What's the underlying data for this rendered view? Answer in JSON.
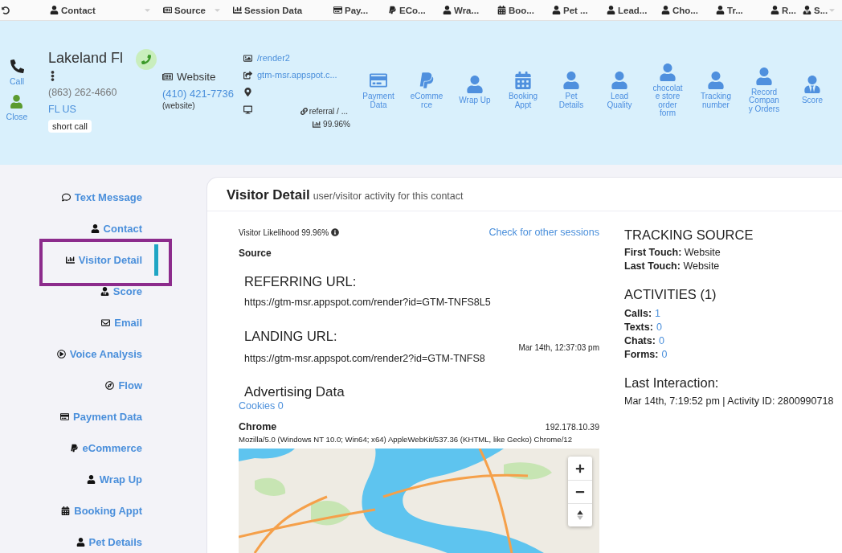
{
  "top_bar": {
    "items": [
      {
        "label": "Contact",
        "dropdown": true
      },
      {
        "label": "Source",
        "dropdown": true
      },
      {
        "label": "Session Data",
        "dropdown": false
      },
      {
        "label": "Pay...",
        "dropdown": false
      },
      {
        "label": "ECo...",
        "dropdown": false
      },
      {
        "label": "Wra...",
        "dropdown": false
      },
      {
        "label": "Boo...",
        "dropdown": false
      },
      {
        "label": "Pet ...",
        "dropdown": false
      },
      {
        "label": "Lead...",
        "dropdown": false
      },
      {
        "label": "Cho...",
        "dropdown": false
      },
      {
        "label": "Tr...",
        "dropdown": false
      },
      {
        "label": "R...",
        "dropdown": false
      },
      {
        "label": "S...",
        "dropdown": true
      }
    ]
  },
  "contact_header": {
    "actions": [
      {
        "label": "Call"
      },
      {
        "label": "Close"
      }
    ],
    "name": "Lakeland Fl",
    "phone": "(863) 262-4660",
    "location": "FL US",
    "tag": "short call",
    "source": {
      "name": "Website",
      "number": "(410) 421-7736",
      "note": "(website)"
    },
    "session": {
      "page": "/render2",
      "referrer": "gtm-msr.appspot.c...",
      "medium": "referral / ...",
      "likelihood": "99.96%"
    },
    "shortcuts": [
      {
        "label": "Payment Data"
      },
      {
        "label": "eCommerce"
      },
      {
        "label": "Wrap Up"
      },
      {
        "label": "Booking Appt"
      },
      {
        "label": "Pet Details"
      },
      {
        "label": "Lead Quality"
      },
      {
        "label": "chocolate store order form"
      },
      {
        "label": "Tracking number"
      },
      {
        "label": "Record Company Orders"
      },
      {
        "label": "Score"
      }
    ]
  },
  "sidebar": {
    "items": [
      {
        "label": "Text Message",
        "selected": false
      },
      {
        "label": "Contact",
        "selected": false
      },
      {
        "label": "Visitor Detail",
        "selected": true
      },
      {
        "label": "Score",
        "selected": false
      },
      {
        "label": "Email",
        "selected": false
      },
      {
        "label": "Voice Analysis",
        "selected": false
      },
      {
        "label": "Flow",
        "selected": false
      },
      {
        "label": "Payment Data",
        "selected": false
      },
      {
        "label": "eCommerce",
        "selected": false
      },
      {
        "label": "Wrap Up",
        "selected": false
      },
      {
        "label": "Booking Appt",
        "selected": false
      },
      {
        "label": "Pet Details",
        "selected": false
      }
    ]
  },
  "visitor_detail": {
    "title": "Visitor Detail",
    "subtitle": "user/visitor activity for this contact",
    "likelihood": "Visitor Likelihood 99.96%",
    "other_sessions_link": "Check for other sessions",
    "source_heading": "Source",
    "referring_url": {
      "heading": "REFERRING URL:",
      "url": "https://gtm-msr.appspot.com/render?id=GTM-TNFS8L5"
    },
    "landing_url": {
      "heading": "LANDING URL:",
      "timestamp": "Mar 14th, 12:37:03 pm",
      "url": "https://gtm-msr.appspot.com/render2?id=GTM-TNFS8"
    },
    "advertising": {
      "heading": "Advertising Data",
      "cookies": "Cookies 0"
    },
    "browser": {
      "name": "Chrome",
      "ip": "192.178.10.39",
      "user_agent": "Mozilla/5.0 (Windows NT 10.0; Win64; x64) AppleWebKit/537.36 (KHTML, like Gecko) Chrome/12"
    },
    "tracking_source": {
      "heading": "TRACKING SOURCE",
      "rows": [
        "**First Touch:** Website",
        "**Last Touch:** Website"
      ]
    },
    "activities": {
      "heading": "ACTIVITIES (1)",
      "rows": [
        {
          "label": "Calls:",
          "value": "1"
        },
        {
          "label": "Texts:",
          "value": "0"
        },
        {
          "label": "Chats:",
          "value": "0"
        },
        {
          "label": "Forms:",
          "value": "0"
        }
      ]
    },
    "last_interaction": {
      "heading": "Last Interaction:",
      "detail": "Mar 14th, 7:19:52 pm | Activity ID: 2800990718"
    }
  }
}
